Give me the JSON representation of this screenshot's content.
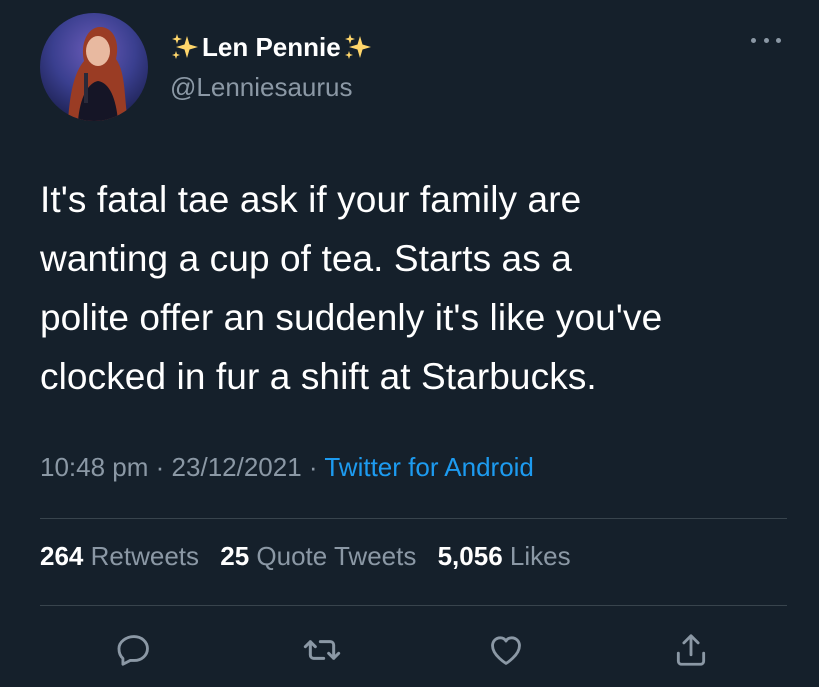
{
  "author": {
    "display_name": "Len Pennie",
    "handle": "@Lenniesaurus",
    "avatar": "avatar-photo",
    "name_decoration_icon": "sparkles-icon"
  },
  "tweet": {
    "lines": [
      "It's fatal tae ask if your family are",
      "wanting a cup of tea. Starts as a",
      "polite offer an suddenly it's like you've",
      "clocked in fur a shift at Starbucks."
    ],
    "time": "10:48 pm",
    "date": "23/12/2021",
    "separator": "·",
    "source": "Twitter for Android"
  },
  "stats": {
    "retweets_count": "264",
    "retweets_label": "Retweets",
    "quotes_count": "25",
    "quotes_label": "Quote Tweets",
    "likes_count": "5,056",
    "likes_label": "Likes"
  },
  "actions": [
    "reply-icon",
    "retweet-icon",
    "like-icon",
    "share-icon"
  ],
  "colors": {
    "background": "#15202b",
    "text": "#ffffff",
    "secondary_text": "#8b98a5",
    "link": "#1d9bf0",
    "divider": "#38444d",
    "sparkle": "#ffd66b"
  }
}
